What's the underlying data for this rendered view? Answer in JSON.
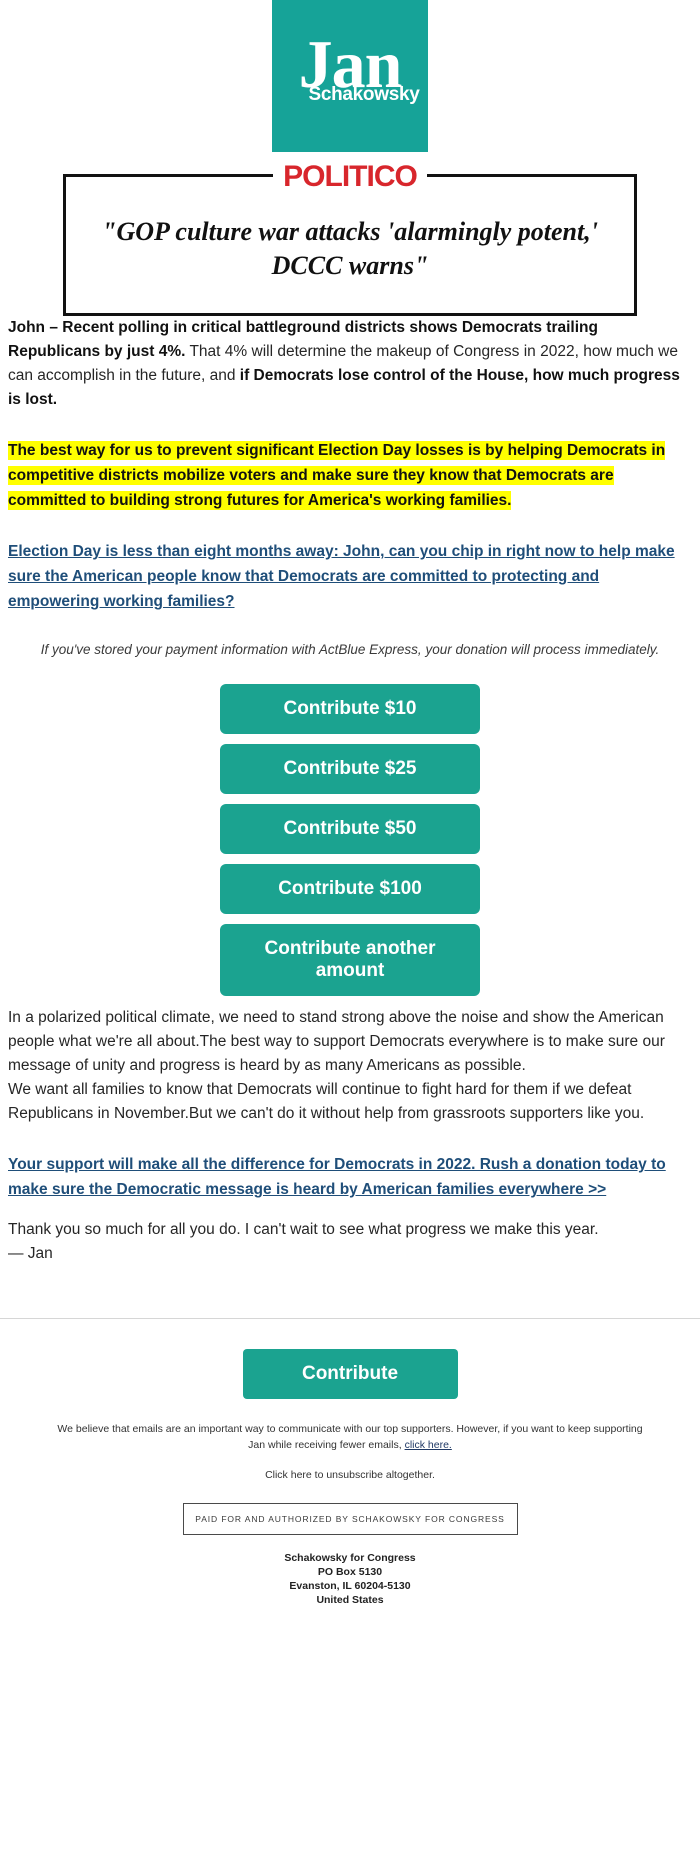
{
  "brand": {
    "logo_name": "Jan",
    "logo_subtitle": "Schakowsky",
    "teal": "#1ba390",
    "logo_teal": "#16a398",
    "politico_red": "#d8262c",
    "link_blue": "#1f4e79",
    "highlight_yellow": "#ffff00"
  },
  "press": {
    "outlet": "POLITICO",
    "headline": "\"GOP culture war attacks 'alarmingly potent,' DCCC warns\""
  },
  "body": {
    "p1_bold_a": "John – Recent polling in critical battleground districts shows Democrats trailing Republicans by just 4%.",
    "p1_normal_a": " That 4% will determine the makeup of Congress in 2022, how much we can accomplish in the future, and ",
    "p1_bold_b": "if Democrats lose control of the House, how much progress is lost.",
    "highlight": "The best way for us to prevent significant Election Day losses is by helping Democrats in competitive districts mobilize voters and make sure they know that Democrats are committed to building strong futures for America's working families.",
    "link_paragraph": "Election Day is less than eight months away: John, can you chip in right now to help make sure the American people know that Democrats are committed to protecting and empowering working families?",
    "actblue_note": "If you've stored your payment information with ActBlue Express, your donation will process immediately.",
    "p_after_1": "In a polarized political climate, we need to stand strong above the noise and show the American people what we're all about.The best way to support Democrats everywhere is to make sure our message of unity and progress is heard by as many Americans as possible.",
    "p_after_2": "We want all families to know that Democrats will continue to fight hard for them if we defeat Republicans in November.But we can't do it without help from grassroots supporters like you.",
    "closing_link": "Your support will make all the difference for Democrats in 2022. Rush a donation today to make sure the Democratic message is heard by American families everywhere >>",
    "thanks": "Thank you so much for all you do. I can't wait to see what progress we make this year.",
    "signature": "— Jan"
  },
  "donation_buttons": [
    {
      "label": "Contribute $10",
      "amount": "10"
    },
    {
      "label": "Contribute $25",
      "amount": "25"
    },
    {
      "label": "Contribute $50",
      "amount": "50"
    },
    {
      "label": "Contribute $100",
      "amount": "100"
    },
    {
      "label": "Contribute another amount",
      "amount": "other"
    }
  ],
  "footer": {
    "contribute_label": "Contribute",
    "fine_print_a": "We believe that emails are an important way to communicate with our top supporters. However, if you want to keep supporting Jan while receiving fewer emails, ",
    "fine_print_link": "click here.",
    "unsubscribe": "Click here to unsubscribe altogether.",
    "paid_for": "PAID FOR AND AUTHORIZED BY SCHAKOWSKY FOR CONGRESS",
    "address_lines": [
      "Schakowsky for Congress",
      "PO Box 5130",
      "Evanston, IL 60204-5130",
      "United States"
    ]
  }
}
